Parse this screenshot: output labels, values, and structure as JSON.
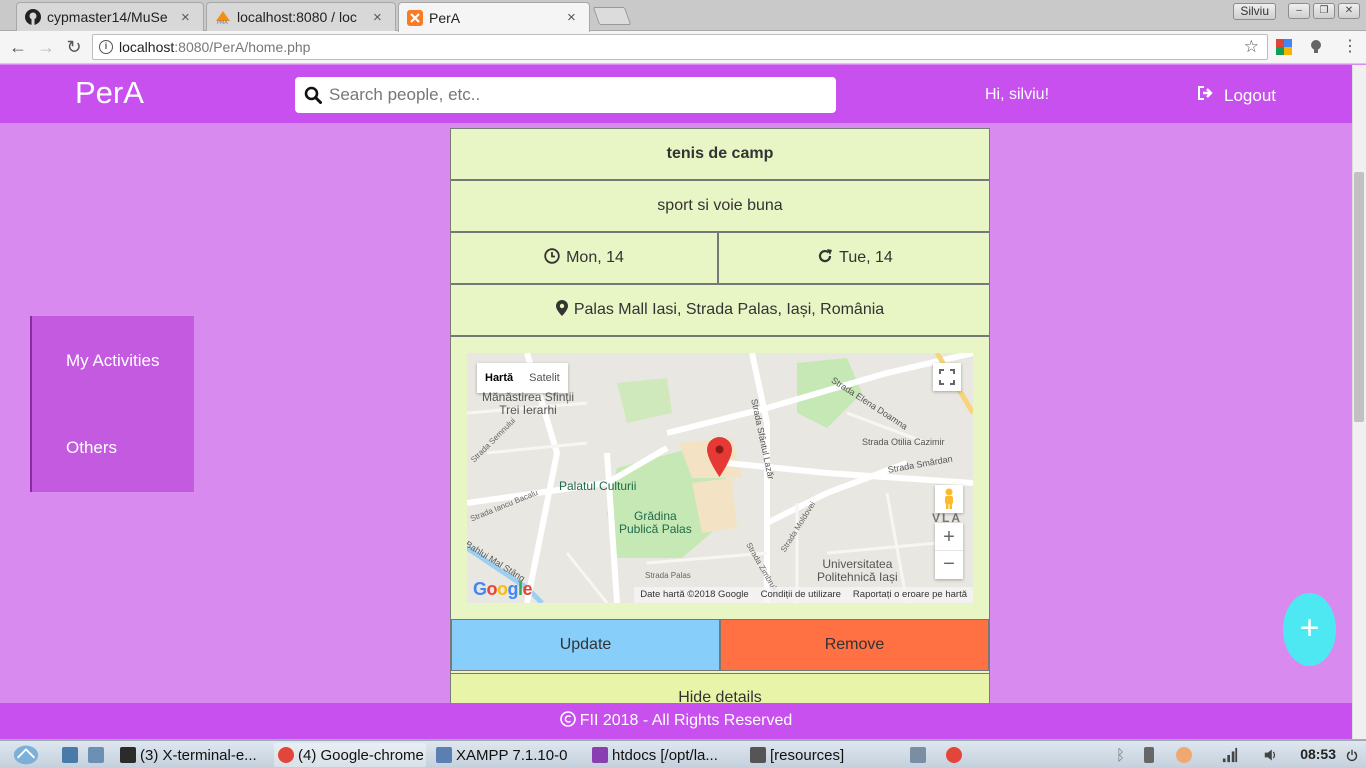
{
  "browser": {
    "tabs": [
      {
        "title": "cypmaster14/MuSe",
        "icon": "github-icon"
      },
      {
        "title": "localhost:8080 / loc",
        "icon": "phpmyadmin-icon"
      },
      {
        "title": "PerA",
        "icon": "xampp-icon",
        "active": true
      }
    ],
    "user_chip": "Silviu",
    "address": {
      "host": "localhost",
      "rest": ":8080/PerA/home.php"
    }
  },
  "header": {
    "brand": "PerA",
    "search_placeholder": "Search people, etc..",
    "greeting": "Hi, silviu!",
    "logout": "Logout"
  },
  "sidebar": {
    "items": [
      {
        "label": "My Activities"
      },
      {
        "label": "Others"
      }
    ]
  },
  "activity": {
    "name": "tenis de camp",
    "description": "sport si voie buna",
    "start": "Mon, 14",
    "end": "Tue, 14",
    "location": "Palas Mall Iasi, Strada Palas, Iași, România",
    "map": {
      "type_buttons": [
        "Hartă",
        "Satelit"
      ],
      "labels": {
        "manastirea": "Mănăstirea Sfinții",
        "manastirea2": "Trei Ierarhi",
        "palatul": "Palatul Culturii",
        "gradina": "Grădina",
        "gradina2": "Publică Palas",
        "univ": "Universitatea",
        "univ2": "Politehnică Iași",
        "elena": "Strada Elena Doamna",
        "sf_lazar": "Strada Sfântul Lazăr",
        "otilia": "Strada Otilia Cazimir",
        "smardan": "Strada Smârdan",
        "semnului": "Strada Semnului",
        "bacalu": "Strada Iancu Bacalu",
        "bahlui": "Bahlui Mal Stâng",
        "palas": "Strada Palas",
        "moldovei": "Strada Moldovei",
        "zimbrului": "Strada Zimbrului",
        "vla": "VLA"
      },
      "footer": [
        "Date hartă ©2018 Google",
        "Condiții de utilizare",
        "Raportați o eroare pe hartă"
      ],
      "google": "Google"
    },
    "update": "Update",
    "remove": "Remove",
    "hide": "Hide details"
  },
  "footer": {
    "text": "FII 2018 - All Rights Reserved"
  },
  "fab": {
    "label": "+"
  },
  "taskbar": {
    "items": [
      {
        "label": "(3) X-terminal-e...",
        "color": "#2b2b2b"
      },
      {
        "label": "(4) Google-chrome",
        "color": "#e4453a"
      },
      {
        "label": "XAMPP 7.1.10-0",
        "color": "#5a7fb0"
      },
      {
        "label": "htdocs [/opt/la...",
        "color": "#8a3fb0"
      },
      {
        "label": "[resources]",
        "color": "#555555"
      }
    ],
    "clock": "08:53"
  },
  "colors": {
    "header": "#c850ee",
    "page": "#d98aef",
    "card": "#e8f5c4",
    "update": "#87cefa",
    "remove": "#ff7043",
    "fab": "#4ee8f3"
  }
}
